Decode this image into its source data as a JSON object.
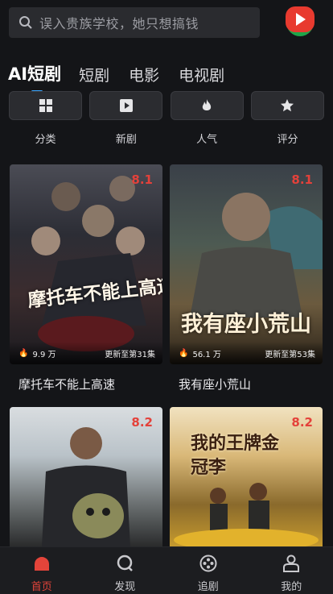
{
  "search": {
    "placeholder": "误入贵族学校，她只想搞钱"
  },
  "tabs": [
    {
      "label": "AI短剧",
      "active": true
    },
    {
      "label": "短剧"
    },
    {
      "label": "电影"
    },
    {
      "label": "电视剧"
    }
  ],
  "categories": [
    {
      "label": "分类",
      "icon": "grid-icon"
    },
    {
      "label": "新剧",
      "icon": "play-icon"
    },
    {
      "label": "人气",
      "icon": "flame-icon"
    },
    {
      "label": "评分",
      "icon": "star-icon"
    }
  ],
  "cards": [
    {
      "title": "摩托车不能上高速",
      "poster_text": "摩托车不能上高速",
      "rating": "8.1",
      "views": "9.9 万",
      "update": "更新至第31集"
    },
    {
      "title": "我有座小荒山",
      "poster_text": "我有座小荒山",
      "rating": "8.1",
      "views": "56.1 万",
      "update": "更新至第53集"
    },
    {
      "poster_text": "",
      "rating": "8.2"
    },
    {
      "poster_text": "我的王牌金冠李",
      "rating": "8.2"
    }
  ],
  "nav": [
    {
      "label": "首页",
      "icon": "home-icon",
      "active": true
    },
    {
      "label": "发现",
      "icon": "discover-icon"
    },
    {
      "label": "追剧",
      "icon": "follow-icon"
    },
    {
      "label": "我的",
      "icon": "profile-icon"
    }
  ],
  "colors": {
    "accent": "#e4443a",
    "tab_indicator": "#3aa6ff",
    "background": "#141518"
  }
}
